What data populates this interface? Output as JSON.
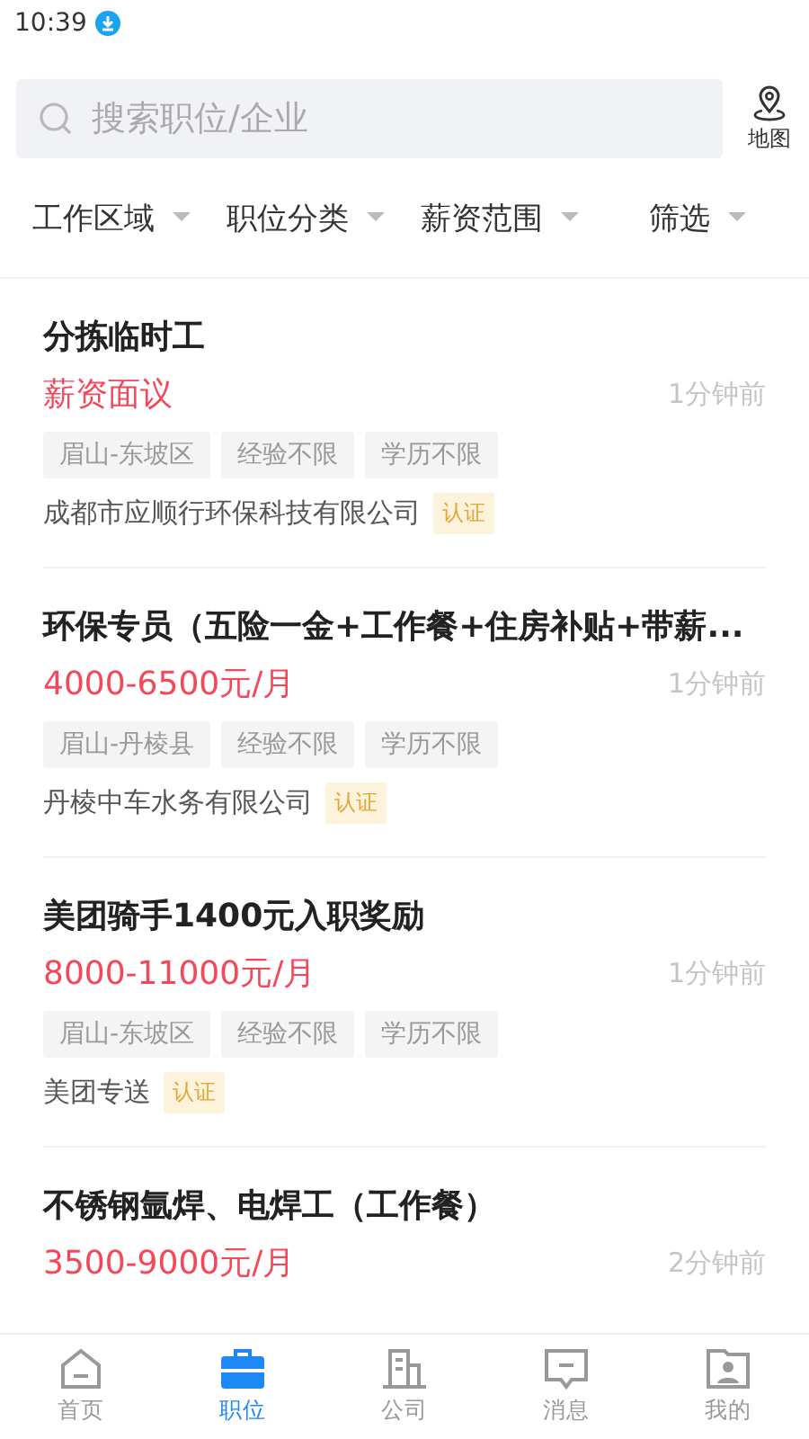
{
  "status_bar": {
    "time": "10:39"
  },
  "search": {
    "placeholder": "搜索职位/企业"
  },
  "map_button": {
    "label": "地图"
  },
  "filters": [
    {
      "label": "工作区域"
    },
    {
      "label": "职位分类"
    },
    {
      "label": "薪资范围"
    },
    {
      "label": "筛选"
    }
  ],
  "jobs": [
    {
      "title": "分拣临时工",
      "salary": "薪资面议",
      "time": "1分钟前",
      "tags": [
        "眉山-东坡区",
        "经验不限",
        "学历不限"
      ],
      "company": "成都市应顺行环保科技有限公司",
      "badge": "认证"
    },
    {
      "title": "环保专员（五险一金+工作餐+住房补贴+带薪...",
      "salary": "4000-6500元/月",
      "time": "1分钟前",
      "tags": [
        "眉山-丹棱县",
        "经验不限",
        "学历不限"
      ],
      "company": "丹棱中车水务有限公司",
      "badge": "认证"
    },
    {
      "title": "美团骑手1400元入职奖励",
      "salary": "8000-11000元/月",
      "time": "1分钟前",
      "tags": [
        "眉山-东坡区",
        "经验不限",
        "学历不限"
      ],
      "company": "美团专送",
      "badge": "认证"
    },
    {
      "title": "不锈钢氩焊、电焊工（工作餐）",
      "salary": "3500-9000元/月",
      "time": "2分钟前"
    }
  ],
  "tab_bar": [
    {
      "kind": "home",
      "label": "首页",
      "selected": false
    },
    {
      "kind": "jobs",
      "label": "职位",
      "selected": true
    },
    {
      "kind": "company",
      "label": "公司",
      "selected": false
    },
    {
      "kind": "message",
      "label": "消息",
      "selected": false
    },
    {
      "kind": "profile",
      "label": "我的",
      "selected": false
    }
  ]
}
